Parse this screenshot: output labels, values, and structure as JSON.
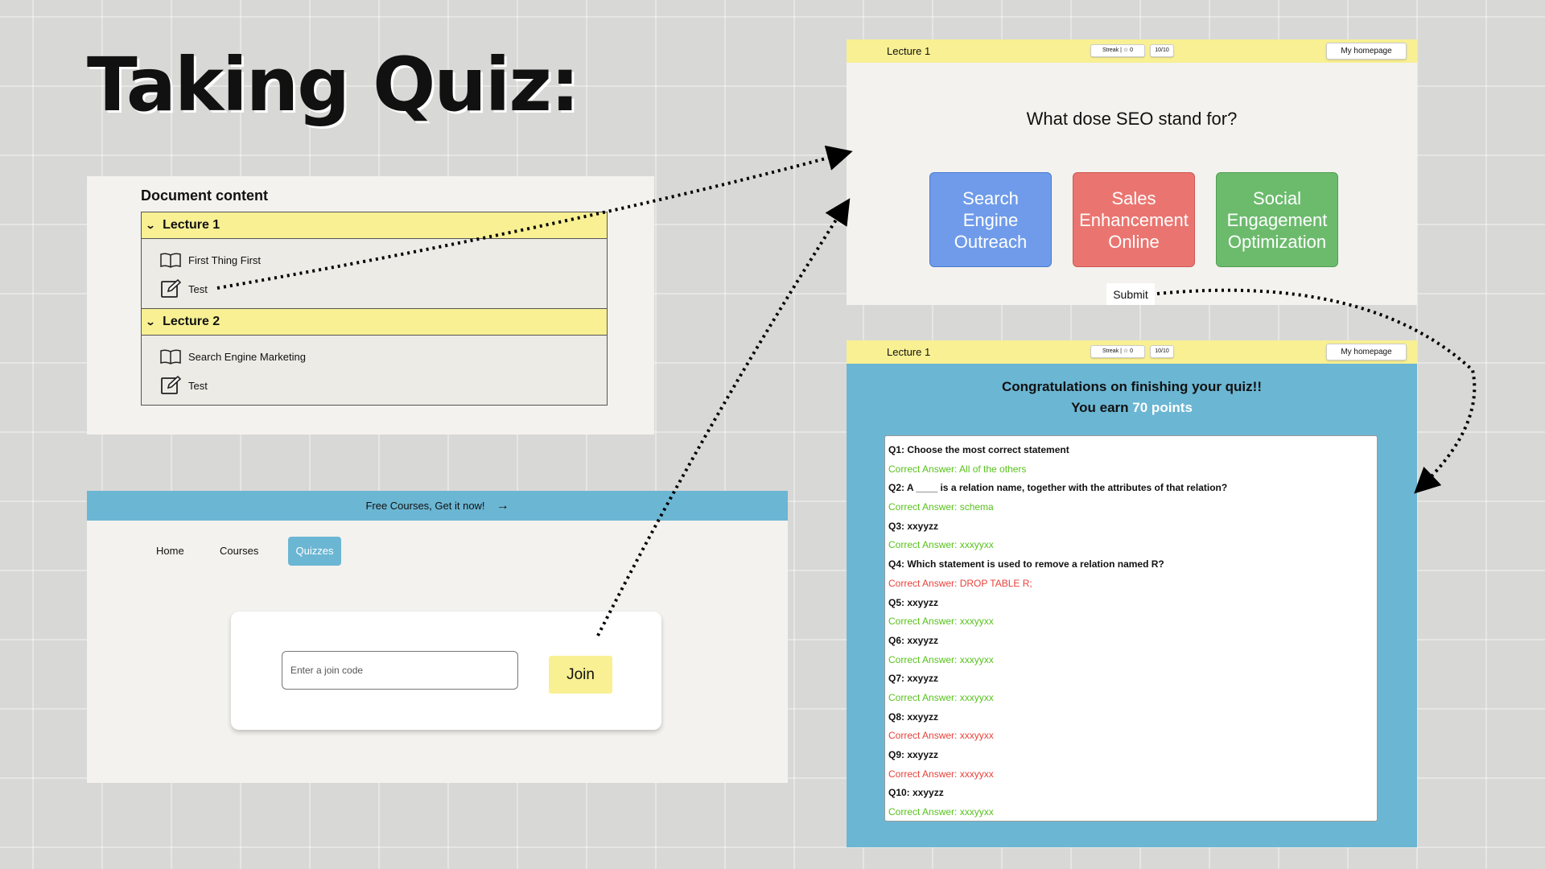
{
  "title": "Taking Quiz:",
  "document_panel": {
    "heading": "Document content",
    "lectures": [
      {
        "label": "Lecture 1",
        "items": [
          {
            "icon": "book-icon",
            "label": "First Thing First"
          },
          {
            "icon": "edit-icon",
            "label": "Test"
          }
        ]
      },
      {
        "label": "Lecture 2",
        "items": [
          {
            "icon": "book-icon",
            "label": "Search Engine Marketing"
          },
          {
            "icon": "edit-icon",
            "label": "Test"
          }
        ]
      }
    ]
  },
  "site_panel": {
    "banner": "Free Courses, Get it now!",
    "banner_arrow": "→",
    "nav": {
      "home": "Home",
      "courses": "Courses",
      "quizzes": "Quizzes"
    },
    "join": {
      "placeholder": "Enter a join code",
      "button": "Join"
    }
  },
  "quiz_panel": {
    "header": {
      "lecture": "Lecture 1",
      "streak": "Streak | ☆ 0",
      "score": "10/10",
      "home": "My homepage"
    },
    "question": "What dose SEO stand for?",
    "answers": [
      "Search Engine Outreach",
      "Sales Enhancement Online",
      "Social Engagement Optimization"
    ],
    "submit": "Submit"
  },
  "result_panel": {
    "header": {
      "lecture": "Lecture 1",
      "streak": "Streak | ☆ 0",
      "score": "10/10",
      "home": "My homepage"
    },
    "congrats": "Congratulations on finishing your quiz!!",
    "earn_prefix": "You earn",
    "points": "70 points",
    "results": [
      {
        "q": "Q1: Choose the most correct statement",
        "a": "Correct Answer: All of the others",
        "correct": true
      },
      {
        "q": "Q2: A ____ is a relation name, together with the attributes of that relation?",
        "a": "Correct Answer: schema",
        "correct": true
      },
      {
        "q": "Q3: xxyyzz",
        "a": "Correct Answer: xxxyyxx",
        "correct": true
      },
      {
        "q": "Q4: Which statement is used to remove a relation named R?",
        "a": "Correct Answer: DROP TABLE R;",
        "correct": false
      },
      {
        "q": "Q5: xxyyzz",
        "a": "Correct Answer: xxxyyxx",
        "correct": true
      },
      {
        "q": "Q6: xxyyzz",
        "a": "Correct Answer: xxxyyxx",
        "correct": true
      },
      {
        "q": "Q7: xxyyzz",
        "a": "Correct Answer: xxxyyxx",
        "correct": true
      },
      {
        "q": "Q8: xxyyzz",
        "a": "Correct Answer: xxxyyxx",
        "correct": false
      },
      {
        "q": "Q9: xxyyzz",
        "a": "Correct Answer: xxxyyxx",
        "correct": false
      },
      {
        "q": "Q10: xxyyzz",
        "a": "Correct Answer: xxxyyxx",
        "correct": true
      }
    ]
  },
  "colors": {
    "highlight_yellow": "#f8f093",
    "accent_blue": "#6bb6d3",
    "answer_blue": "#6f9bea",
    "answer_red": "#ea7570",
    "answer_green": "#6cbb6d",
    "correct_green": "#58c21c",
    "wrong_red": "#e8413a"
  }
}
